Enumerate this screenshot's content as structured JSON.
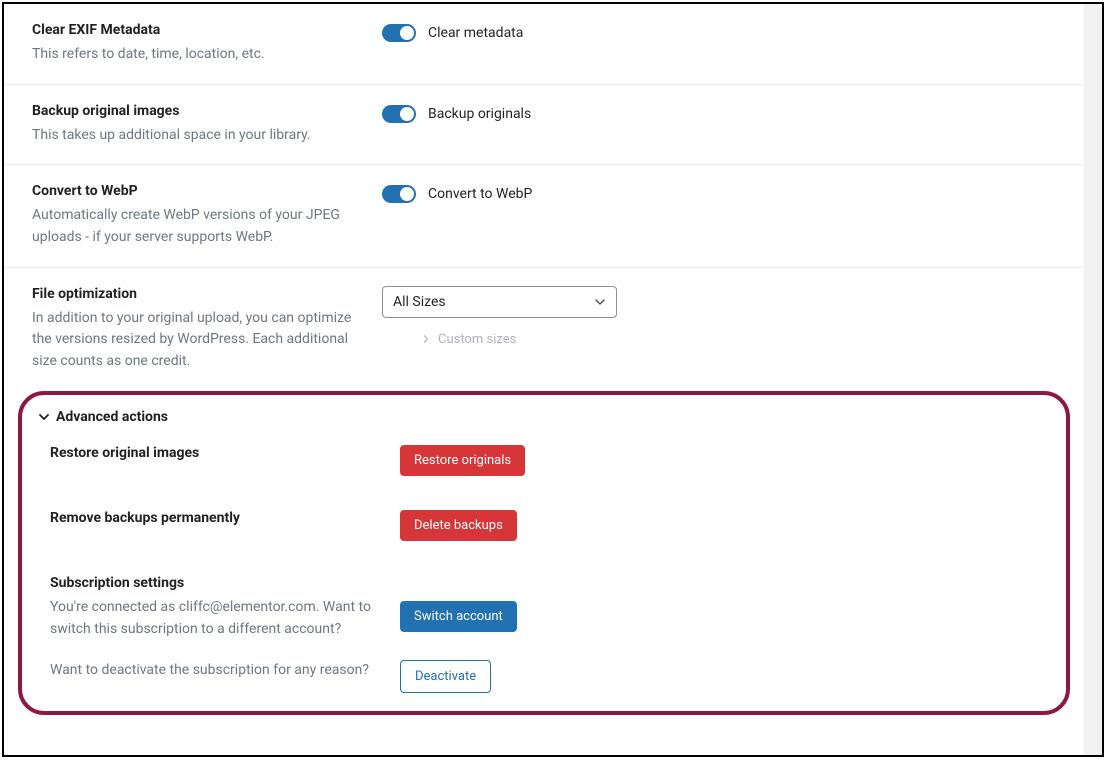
{
  "settings": {
    "exif": {
      "title": "Clear EXIF Metadata",
      "desc": "This refers to date, time, location, etc.",
      "toggle_label": "Clear metadata",
      "enabled": true
    },
    "backup": {
      "title": "Backup original images",
      "desc": "This takes up additional space in your library.",
      "toggle_label": "Backup originals",
      "enabled": true
    },
    "webp": {
      "title": "Convert to WebP",
      "desc": "Automatically create WebP versions of your JPEG uploads - if your server supports WebP.",
      "toggle_label": "Convert to WebP",
      "enabled": true
    },
    "file_opt": {
      "title": "File optimization",
      "desc": "In addition to your original upload, you can optimize the versions resized by WordPress. Each additional size counts as one credit.",
      "selected": "All Sizes",
      "custom_sizes_label": "Custom sizes"
    }
  },
  "advanced": {
    "header": "Advanced actions",
    "restore": {
      "title": "Restore original images",
      "button": "Restore originals"
    },
    "remove_backups": {
      "title": "Remove backups permanently",
      "button": "Delete backups"
    },
    "subscription": {
      "title": "Subscription settings",
      "desc": "You're connected as cliffc@elementor.com. Want to switch this subscription to a different account?",
      "button": "Switch account"
    },
    "deactivate": {
      "desc": "Want to deactivate the subscription for any reason?",
      "button": "Deactivate"
    }
  }
}
